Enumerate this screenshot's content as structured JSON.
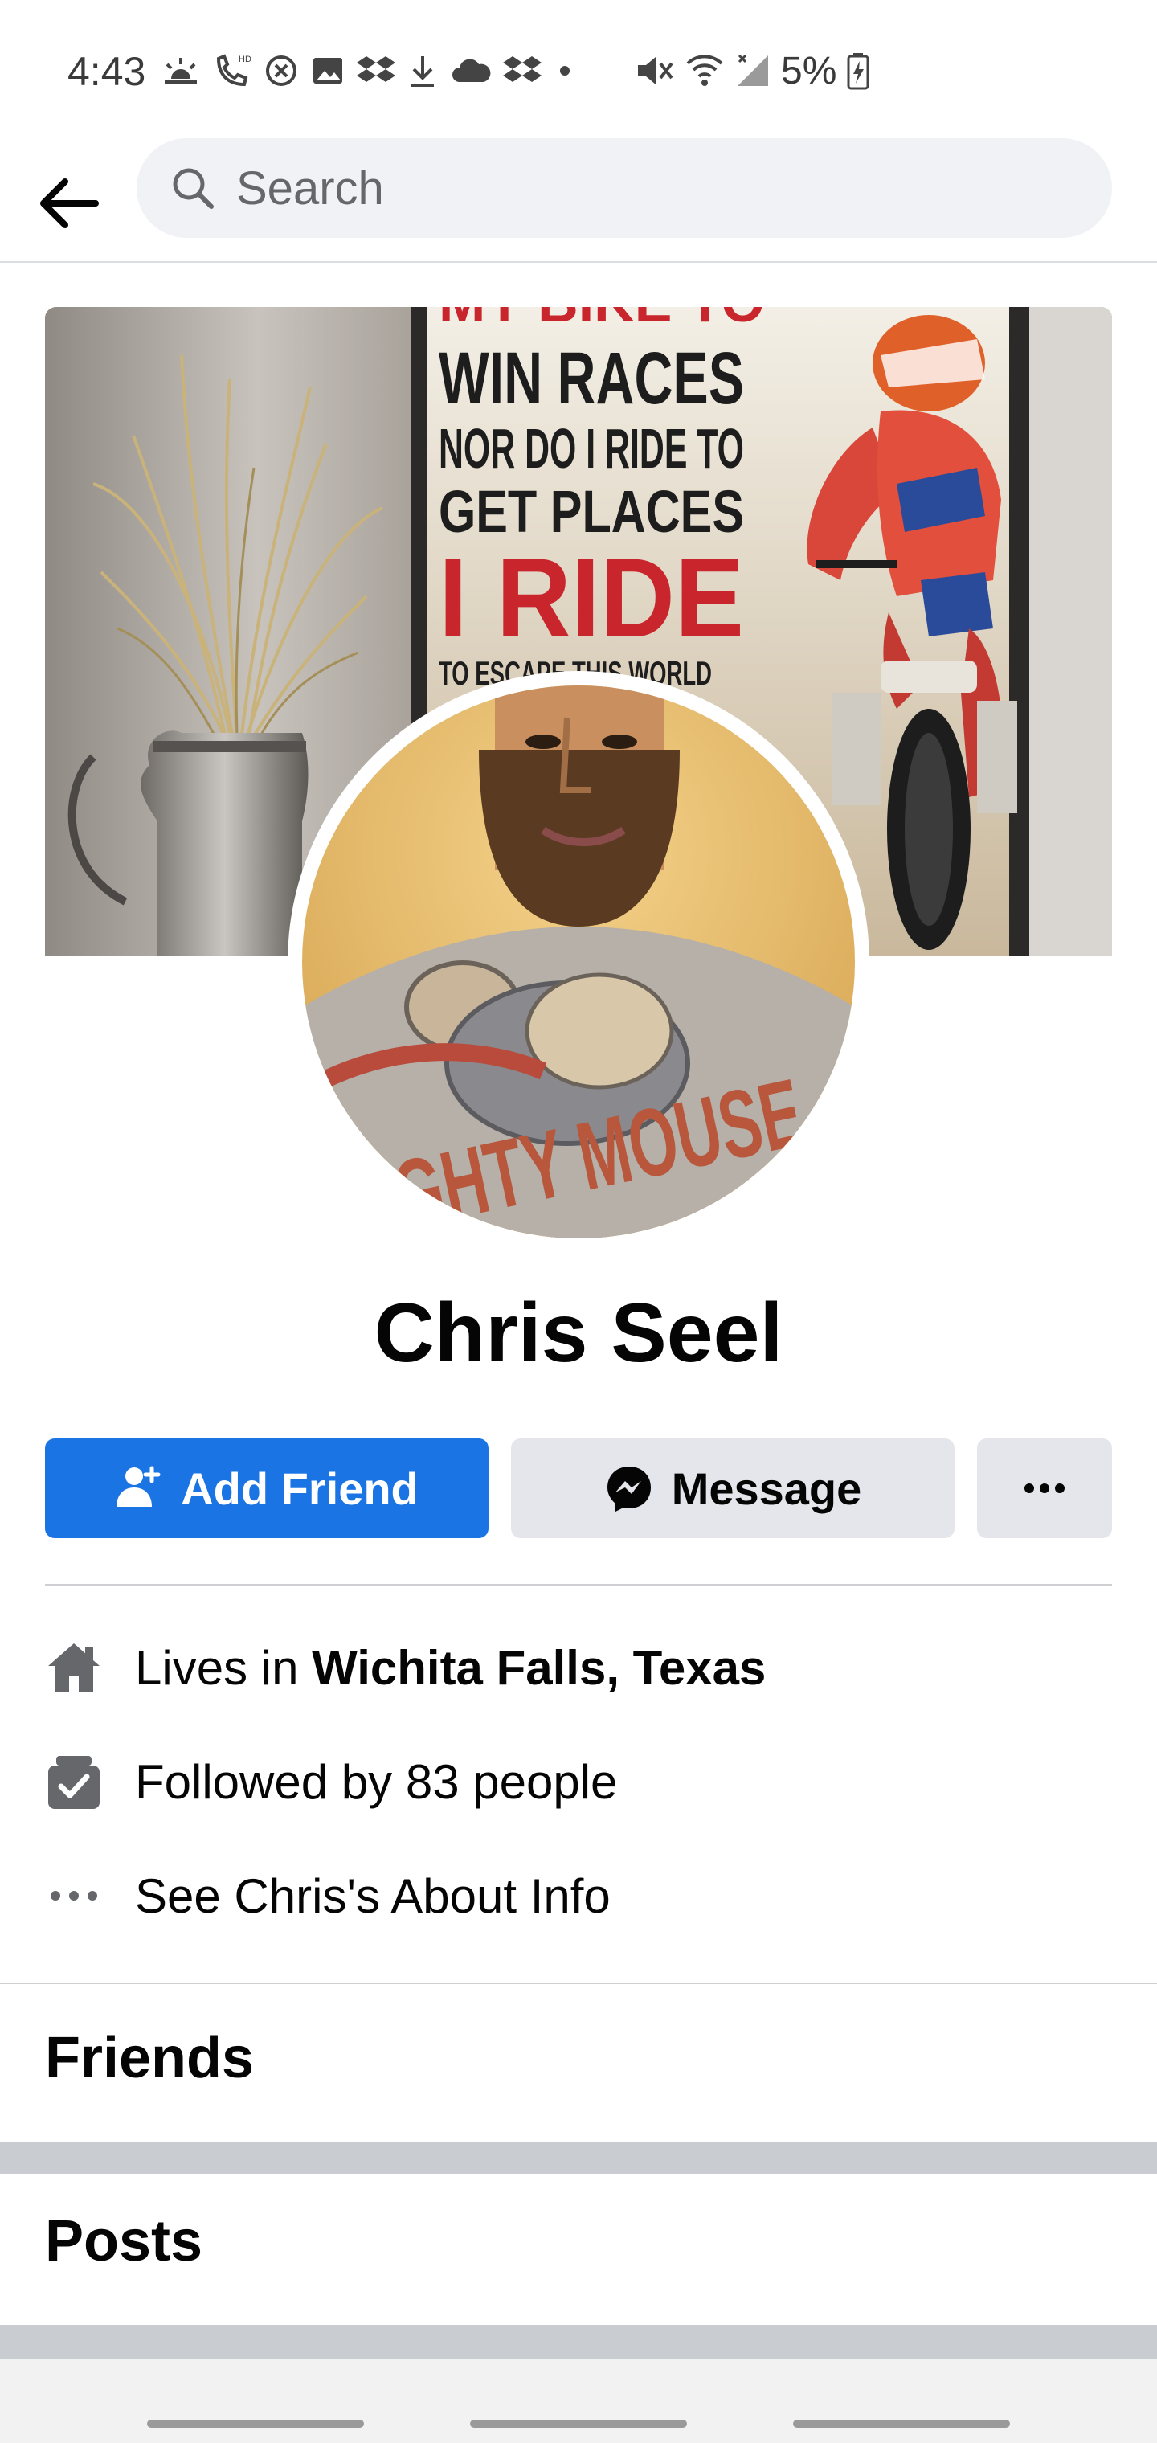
{
  "status_bar": {
    "time": "4:43",
    "battery": "5%",
    "icons": [
      "weather-sunrise-icon",
      "phone-hd-icon",
      "blocked-icon",
      "gallery-icon",
      "dropbox-icon",
      "download-icon",
      "cloud-icon",
      "dropbox-icon",
      "dot-icon",
      "mute-icon",
      "wifi-icon",
      "signal-icon",
      "battery-charging-icon"
    ]
  },
  "header": {
    "back_icon": "arrow-left-icon",
    "search_placeholder": "Search"
  },
  "profile": {
    "name": "Chris Seel",
    "cover_text": {
      "line1": "MY BIKE TO",
      "line2": "WIN RACES",
      "line3": "NOR DO I RIDE TO",
      "line4": "GET PLACES",
      "line5": "I RIDE",
      "line6": "TO ESCAPE THIS WORLD"
    },
    "shirt_text": "MIGHTY MOUSE"
  },
  "actions": {
    "add_friend": "Add Friend",
    "message": "Message",
    "more_icon": "ellipsis-icon"
  },
  "intro": {
    "lives_prefix": "Lives in ",
    "lives_location": "Wichita Falls, Texas",
    "followers": "Followed by 83 people",
    "about": "See Chris's About Info"
  },
  "sections": {
    "friends": "Friends",
    "posts": "Posts"
  },
  "colors": {
    "primary": "#1b74e4",
    "secondary_button": "#e4e6eb",
    "search_bg": "#f0f2f5",
    "icon_grey": "#65676b",
    "band_grey": "#c9ccd1"
  }
}
